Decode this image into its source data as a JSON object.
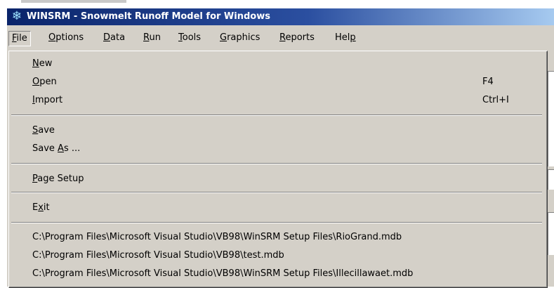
{
  "window": {
    "title": "WINSRM - Snowmelt Runoff Model for Windows",
    "icon": "snowflake-icon"
  },
  "menubar": [
    {
      "key": "F",
      "rest": "ile",
      "active": true
    },
    {
      "key": "O",
      "rest": "ptions"
    },
    {
      "key": "D",
      "rest": "ata"
    },
    {
      "key": "R",
      "rest": "un"
    },
    {
      "key": "T",
      "rest": "ools"
    },
    {
      "key": "G",
      "rest": "raphics"
    },
    {
      "key": "R",
      "rest": "eports"
    },
    {
      "pre": "Hel",
      "key": "p",
      "rest": ""
    }
  ],
  "file_menu": {
    "new": {
      "key": "N",
      "rest": "ew"
    },
    "open": {
      "key": "O",
      "rest": "pen",
      "shortcut": "F4"
    },
    "import": {
      "key": "I",
      "rest": "mport",
      "shortcut": "Ctrl+I"
    },
    "save": {
      "key": "S",
      "rest": "ave"
    },
    "save_as": {
      "pre": "Save ",
      "key": "A",
      "rest": "s ..."
    },
    "page_setup": {
      "key": "P",
      "rest": "age Setup"
    },
    "exit": {
      "pre": "E",
      "key": "x",
      "rest": "it"
    },
    "recent_files": [
      "C:\\Program Files\\Microsoft Visual Studio\\VB98\\WinSRM Setup Files\\RioGrand.mdb",
      "C:\\Program Files\\Microsoft Visual Studio\\VB98\\test.mdb",
      "C:\\Program Files\\Microsoft Visual Studio\\VB98\\WinSRM Setup Files\\Illecillawaet.mdb"
    ]
  }
}
